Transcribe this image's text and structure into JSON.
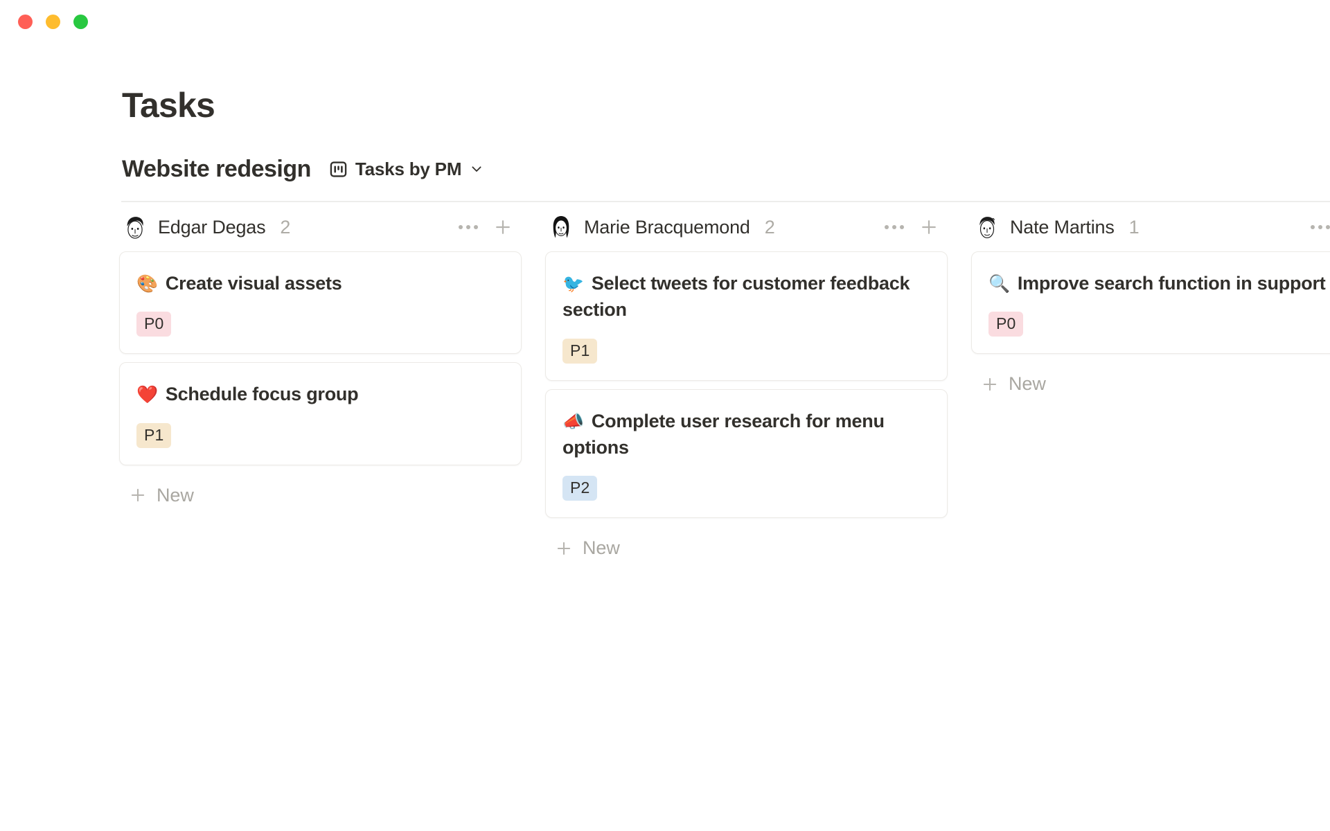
{
  "window": {
    "traffic_lights": [
      {
        "name": "close",
        "color": "#ff5f56"
      },
      {
        "name": "minimize",
        "color": "#febc2e"
      },
      {
        "name": "zoom",
        "color": "#28c840"
      }
    ]
  },
  "header": {
    "page_title": "Tasks",
    "board_name": "Website redesign",
    "view_label": "Tasks by PM",
    "view_icon": "board-view-icon",
    "chevron_icon": "chevron-down-icon"
  },
  "badge_colors": {
    "P0": "#fadce0",
    "P1": "#f6e7cd",
    "P2": "#d5e5f4"
  },
  "labels": {
    "new": "New",
    "more_icon": "more-options-icon",
    "add_icon": "plus-icon"
  },
  "board": {
    "columns": [
      {
        "name": "Edgar Degas",
        "count": "2",
        "avatar": "avatar-edgar-degas",
        "cards": [
          {
            "emoji": "🎨",
            "emoji_name": "palette-emoji",
            "title": "Create visual assets",
            "priority": "P0"
          },
          {
            "emoji": "❤️",
            "emoji_name": "red-heart-emoji",
            "title": "Schedule focus group",
            "priority": "P1"
          }
        ]
      },
      {
        "name": "Marie Bracquemond",
        "count": "2",
        "avatar": "avatar-marie-bracquemond",
        "cards": [
          {
            "emoji": "🐦",
            "emoji_name": "bird-emoji",
            "title": "Select tweets for customer feedback section",
            "priority": "P1"
          },
          {
            "emoji": "📣",
            "emoji_name": "megaphone-emoji",
            "title": "Complete user research for menu options",
            "priority": "P2"
          }
        ]
      },
      {
        "name": "Nate Martins",
        "count": "1",
        "avatar": "avatar-nate-martins",
        "cards": [
          {
            "emoji": "🔍",
            "emoji_name": "magnifying-glass-emoji",
            "title": "Improve search function in support",
            "priority": "P0"
          }
        ]
      }
    ]
  }
}
